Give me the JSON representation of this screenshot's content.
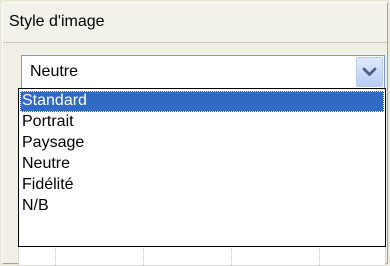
{
  "panel": {
    "title": "Style d'image"
  },
  "combo": {
    "value": "Neutre",
    "button_icon": "chevron-down-icon"
  },
  "dropdown": {
    "selected_index": 0,
    "items": [
      {
        "label": "Standard"
      },
      {
        "label": "Portrait"
      },
      {
        "label": "Paysage"
      },
      {
        "label": "Neutre"
      },
      {
        "label": "Fidélité"
      },
      {
        "label": "N/B"
      }
    ]
  },
  "colors": {
    "selected_bg": "#316ac5",
    "selected_fg": "#ffffff",
    "combo_border": "#7f9db9",
    "arrow": "#4d6185"
  }
}
